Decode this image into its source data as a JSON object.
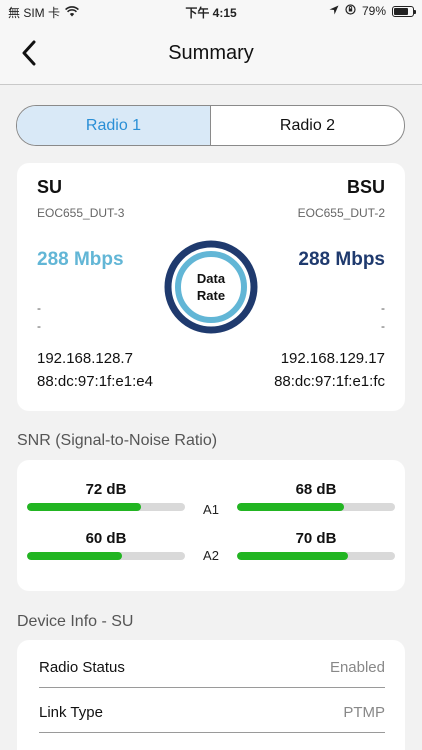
{
  "status_bar": {
    "carrier": "無 SIM 卡",
    "time": "下午 4:15",
    "battery": "79%",
    "battery_level": 0.79
  },
  "nav": {
    "title": "Summary"
  },
  "tabs": [
    {
      "label": "Radio 1",
      "active": true
    },
    {
      "label": "Radio 2",
      "active": false
    }
  ],
  "summary": {
    "su": {
      "title": "SU",
      "device": "EOC655_DUT-3",
      "rate": "288 Mbps",
      "line1": "-",
      "line2": "-",
      "ip": "192.168.128.7",
      "mac": "88:dc:97:1f:e1:e4"
    },
    "bsu": {
      "title": "BSU",
      "device": "EOC655_DUT-2",
      "rate": "288 Mbps",
      "line1": "-",
      "line2": "-",
      "ip": "192.168.129.17",
      "mac": "88:dc:97:1f:e1:fc"
    },
    "gauge_line1": "Data",
    "gauge_line2": "Rate"
  },
  "snr": {
    "title": "SNR (Signal-to-Noise Ratio)",
    "rows": [
      {
        "antenna": "A1",
        "su_label": "72 dB",
        "su_fill": 0.72,
        "bsu_label": "68 dB",
        "bsu_fill": 0.68
      },
      {
        "antenna": "A2",
        "su_label": "60 dB",
        "su_fill": 0.6,
        "bsu_label": "70 dB",
        "bsu_fill": 0.7
      }
    ]
  },
  "device_info": {
    "title": "Device Info - SU",
    "rows": [
      {
        "label": "Radio Status",
        "value": "Enabled"
      },
      {
        "label": "Link Type",
        "value": "PTMP"
      }
    ]
  },
  "colors": {
    "accent": "#2a8fd6",
    "su_rate": "#62b6d6",
    "bsu_rate": "#1f3a6e",
    "snr_bar": "#22b522"
  }
}
